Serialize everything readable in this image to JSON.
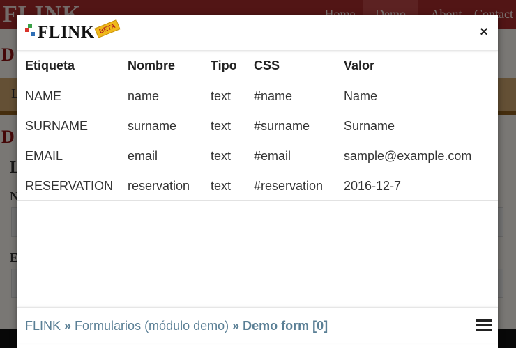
{
  "background": {
    "logo": "FLINK",
    "logo_badge": "BETA",
    "nav": [
      "Home",
      "Demo",
      "About",
      "Contact"
    ],
    "heading_1": "D",
    "band_text": "L",
    "heading_2": "D",
    "sub_heading": "L",
    "label_1": "N",
    "label_2": "E"
  },
  "modal": {
    "logo_text": "FLINK",
    "logo_badge": "BETA",
    "close_label": "×",
    "table": {
      "headers": [
        "Etiqueta",
        "Nombre",
        "Tipo",
        "CSS",
        "Valor"
      ],
      "rows": [
        [
          "NAME",
          "name",
          "text",
          "#name",
          "Name"
        ],
        [
          "SURNAME",
          "surname",
          "text",
          "#surname",
          "Surname"
        ],
        [
          "EMAIL",
          "email",
          "text",
          "#email",
          "sample@example.com"
        ],
        [
          "RESERVATION",
          "reservation",
          "text",
          "#reservation",
          "2016-12-7"
        ]
      ]
    },
    "breadcrumb": {
      "root": "FLINK",
      "sep": "»",
      "module": "Formularios (módulo demo)",
      "current": "Demo form [0]"
    }
  },
  "colors": {
    "nav_bg": "#a52a2a",
    "link": "#5a7f95",
    "beta_badge": "#f0b91a"
  },
  "icons": {
    "close": "close-icon",
    "menu": "hamburger-menu-icon",
    "logo": "flink-logo-icon"
  }
}
